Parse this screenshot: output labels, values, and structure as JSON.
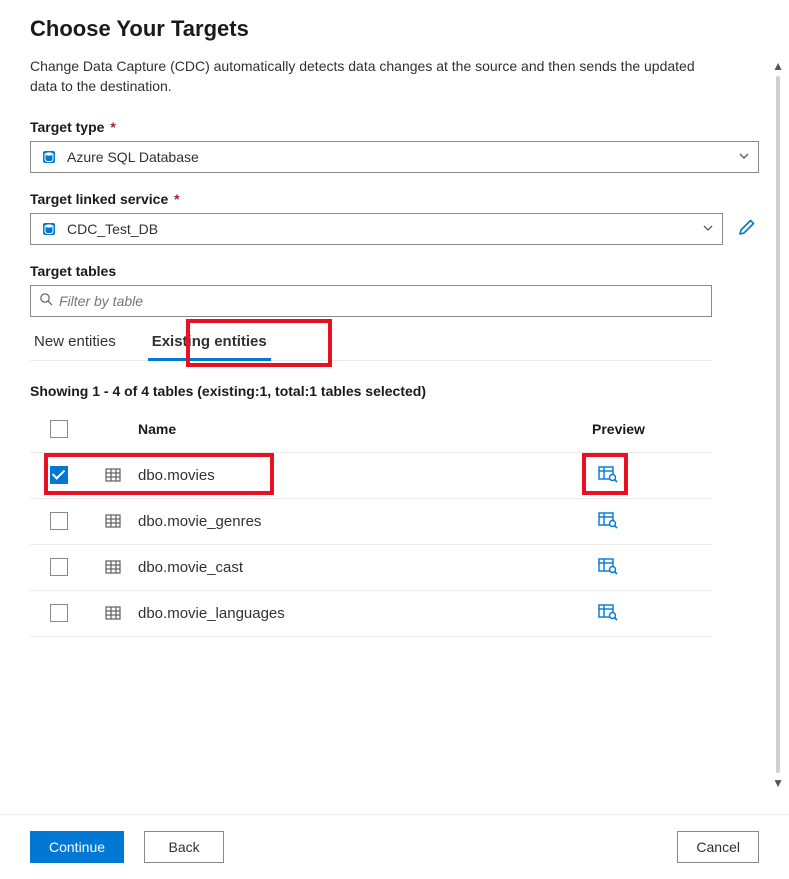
{
  "header": {
    "title": "Choose Your Targets",
    "description": "Change Data Capture (CDC) automatically detects data changes at the source and then sends the updated data to the destination."
  },
  "target_type": {
    "label": "Target type",
    "value": "Azure SQL Database"
  },
  "target_linked_service": {
    "label": "Target linked service",
    "value": "CDC_Test_DB"
  },
  "target_tables": {
    "label": "Target tables",
    "filter_placeholder": "Filter by table"
  },
  "tabs": {
    "new": "New entities",
    "existing": "Existing entities",
    "active": "existing"
  },
  "summary": "Showing 1 - 4 of 4 tables (existing:1, total:1 tables selected)",
  "columns": {
    "name": "Name",
    "preview": "Preview"
  },
  "rows": [
    {
      "name": "dbo.movies",
      "checked": true
    },
    {
      "name": "dbo.movie_genres",
      "checked": false
    },
    {
      "name": "dbo.movie_cast",
      "checked": false
    },
    {
      "name": "dbo.movie_languages",
      "checked": false
    }
  ],
  "footer": {
    "continue": "Continue",
    "back": "Back",
    "cancel": "Cancel"
  }
}
